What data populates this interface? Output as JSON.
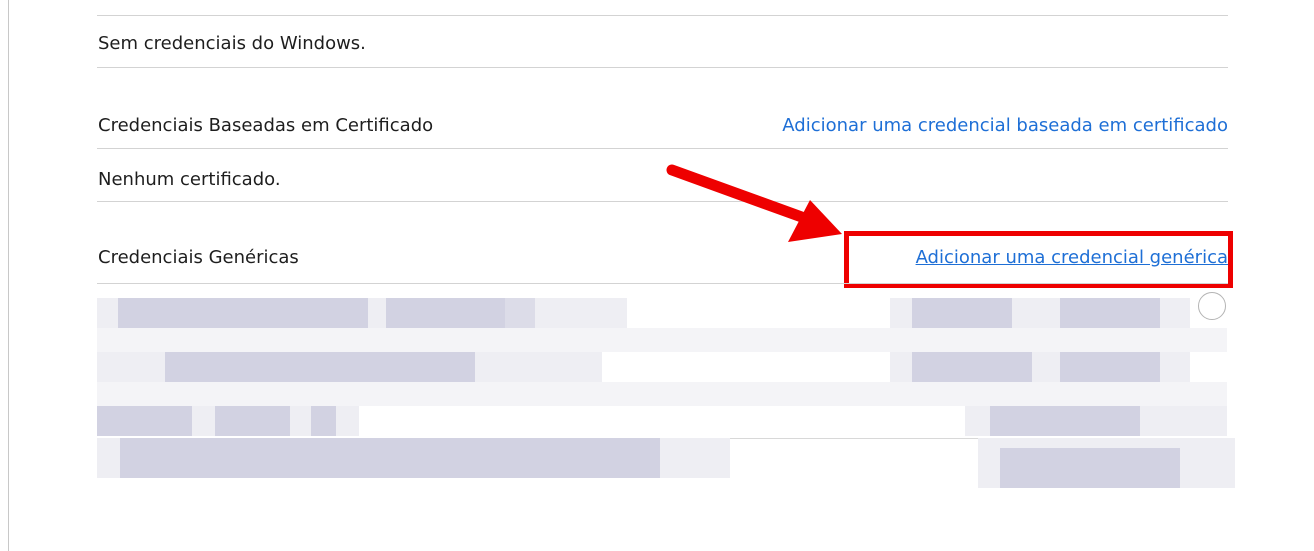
{
  "windows_credentials": {
    "empty_text": "Sem credenciais do Windows."
  },
  "certificate_credentials": {
    "title": "Credenciais Baseadas em Certificado",
    "add_link": "Adicionar uma credencial baseada em certificado",
    "empty_text": "Nenhum certificado."
  },
  "generic_credentials": {
    "title": "Credenciais Genéricas",
    "add_link": "Adicionar uma credencial genérica"
  },
  "annotation": {
    "highlight_color": "#ee0000",
    "link_color": "#1e6fd6"
  }
}
